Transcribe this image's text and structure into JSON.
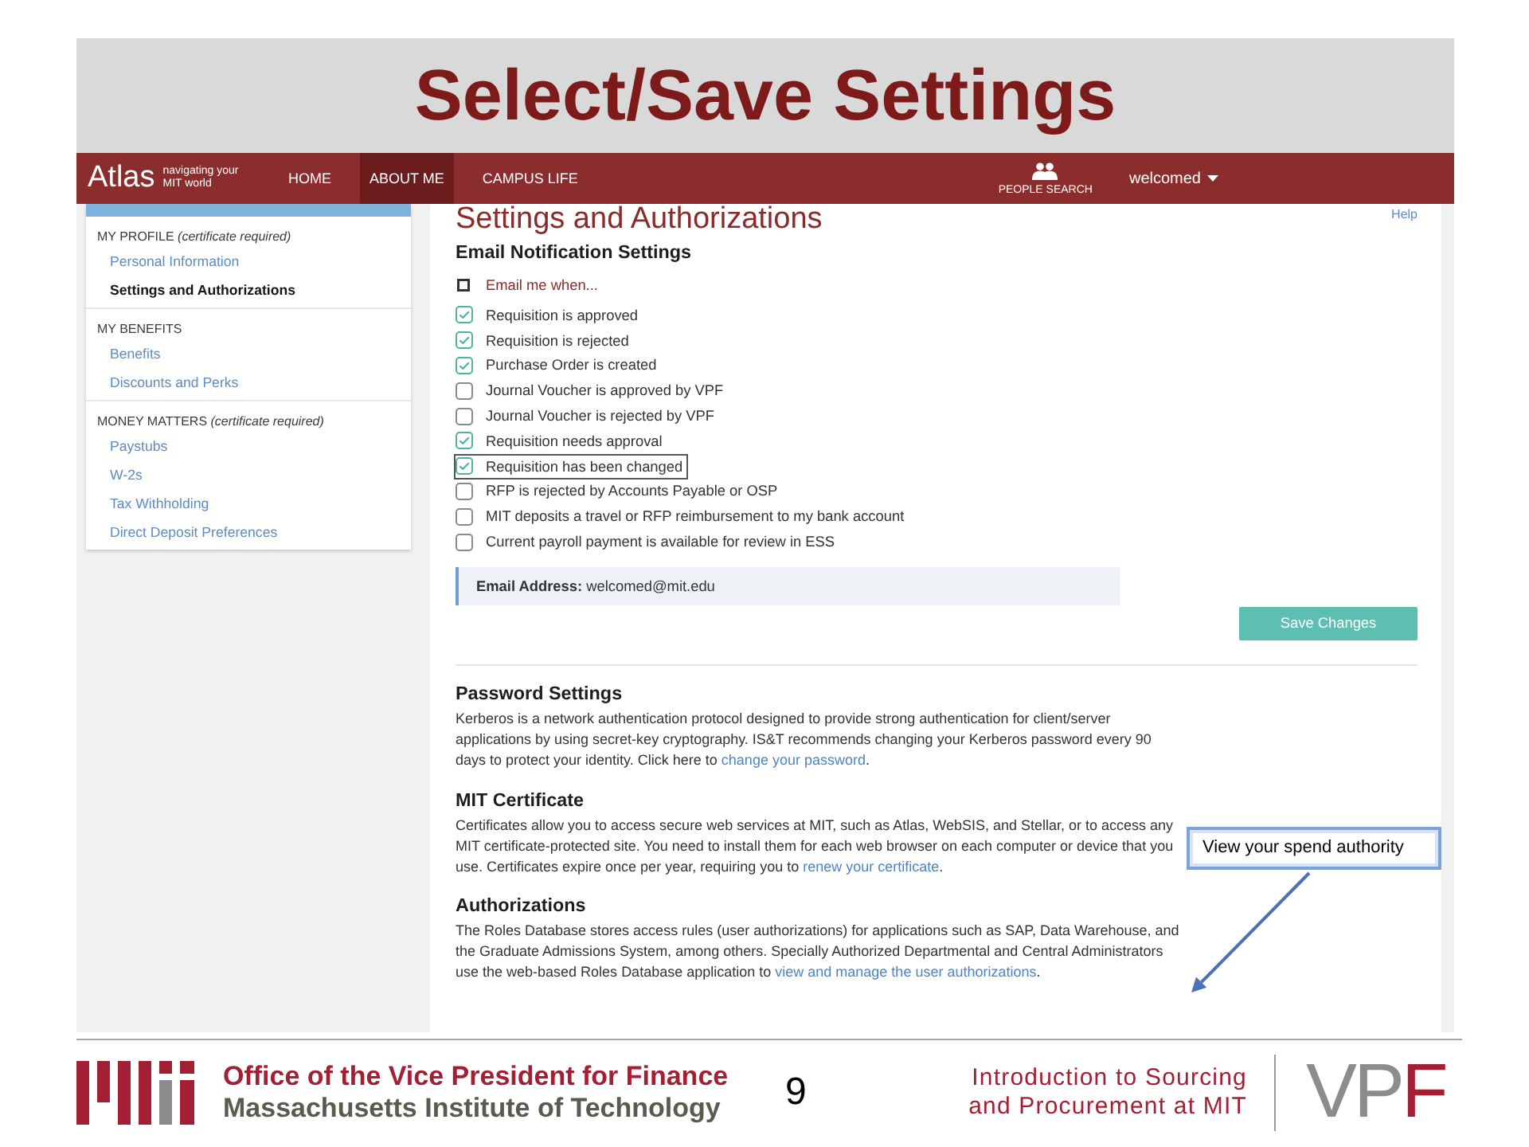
{
  "slide_title": "Select/Save Settings",
  "nav": {
    "logo": "Atlas",
    "tagline": "navigating your MIT world",
    "items": [
      {
        "label": "HOME",
        "selected": false
      },
      {
        "label": "ABOUT ME",
        "selected": true
      },
      {
        "label": "CAMPUS LIFE",
        "selected": false
      }
    ],
    "people_search": "PEOPLE SEARCH",
    "user": "welcomed"
  },
  "sidebar": {
    "groups": [
      {
        "heading": "MY PROFILE *(certificate required)*",
        "items": [
          {
            "label": "Personal Information",
            "selected": false
          },
          {
            "label": "Settings and Authorizations",
            "selected": true
          }
        ]
      },
      {
        "heading": "MY BENEFITS",
        "items": [
          {
            "label": "Benefits",
            "selected": false
          },
          {
            "label": "Discounts and Perks",
            "selected": false
          }
        ]
      },
      {
        "heading": "MONEY MATTERS *(certificate required)*",
        "items": [
          {
            "label": "Paystubs",
            "selected": false
          },
          {
            "label": "W-2s",
            "selected": false
          },
          {
            "label": "Tax Withholding",
            "selected": false
          },
          {
            "label": "Direct Deposit Preferences",
            "selected": false
          }
        ]
      }
    ]
  },
  "page": {
    "title": "Settings and Authorizations",
    "help": "Help",
    "email_settings": {
      "heading": "Email Notification Settings",
      "select_all": {
        "label": "Email me when...",
        "checked": false
      },
      "options": [
        {
          "label": "Requisition is approved",
          "checked": true,
          "focused": false
        },
        {
          "label": "Requisition is rejected",
          "checked": true,
          "focused": false
        },
        {
          "label": "Purchase Order is created",
          "checked": true,
          "focused": false
        },
        {
          "label": "Journal Voucher is approved by VPF",
          "checked": false,
          "focused": false
        },
        {
          "label": "Journal Voucher is rejected by VPF",
          "checked": false,
          "focused": false
        },
        {
          "label": "Requisition needs approval",
          "checked": true,
          "focused": false
        },
        {
          "label": "Requisition has been changed",
          "checked": true,
          "focused": true
        },
        {
          "label": "RFP is rejected by Accounts Payable or OSP",
          "checked": false,
          "focused": false
        },
        {
          "label": "MIT deposits a travel or RFP reimbursement to my bank account",
          "checked": false,
          "focused": false
        },
        {
          "label": "Current payroll payment is available for review in ESS",
          "checked": false,
          "focused": false
        }
      ],
      "email_address": "**Email Address:** welcomed@mit.edu",
      "save_button": "Save Changes"
    },
    "sections": [
      {
        "heading": "Password Settings",
        "text": "Kerberos is a network authentication protocol designed to provide strong authentication for client/server applications by using secret-key cryptography. IS&T recommends changing your Kerberos password every 90 days to protect your identity. Click here to",
        "link": "change your password",
        "after": "."
      },
      {
        "heading": "MIT Certificate",
        "text": "Certificates allow you to access secure web services at MIT, such as Atlas, WebSIS, and Stellar, or to access any MIT certificate-protected site. You need to install them for each web browser on each computer or device that you use. Certificates expire once per year, requiring you to",
        "link": "renew your certificate",
        "after": "."
      },
      {
        "heading": "Authorizations",
        "text": "The Roles Database stores access rules (user authorizations) for applications such as SAP, Data Warehouse, and the Graduate Admissions System, among others. Specially Authorized Departmental and Central Administrators use the web-based Roles Database application to",
        "link": "view and manage the user authorizations",
        "after": "."
      }
    ]
  },
  "callout": {
    "text": "View your spend authority"
  },
  "footer": {
    "office": "Office of the Vice President for Finance",
    "institute": "Massachusetts Institute of Technology",
    "page_number": "9",
    "course": "Introduction to Sourcing and Procurement at MIT",
    "logo_parts": [
      "VP",
      "F"
    ]
  }
}
